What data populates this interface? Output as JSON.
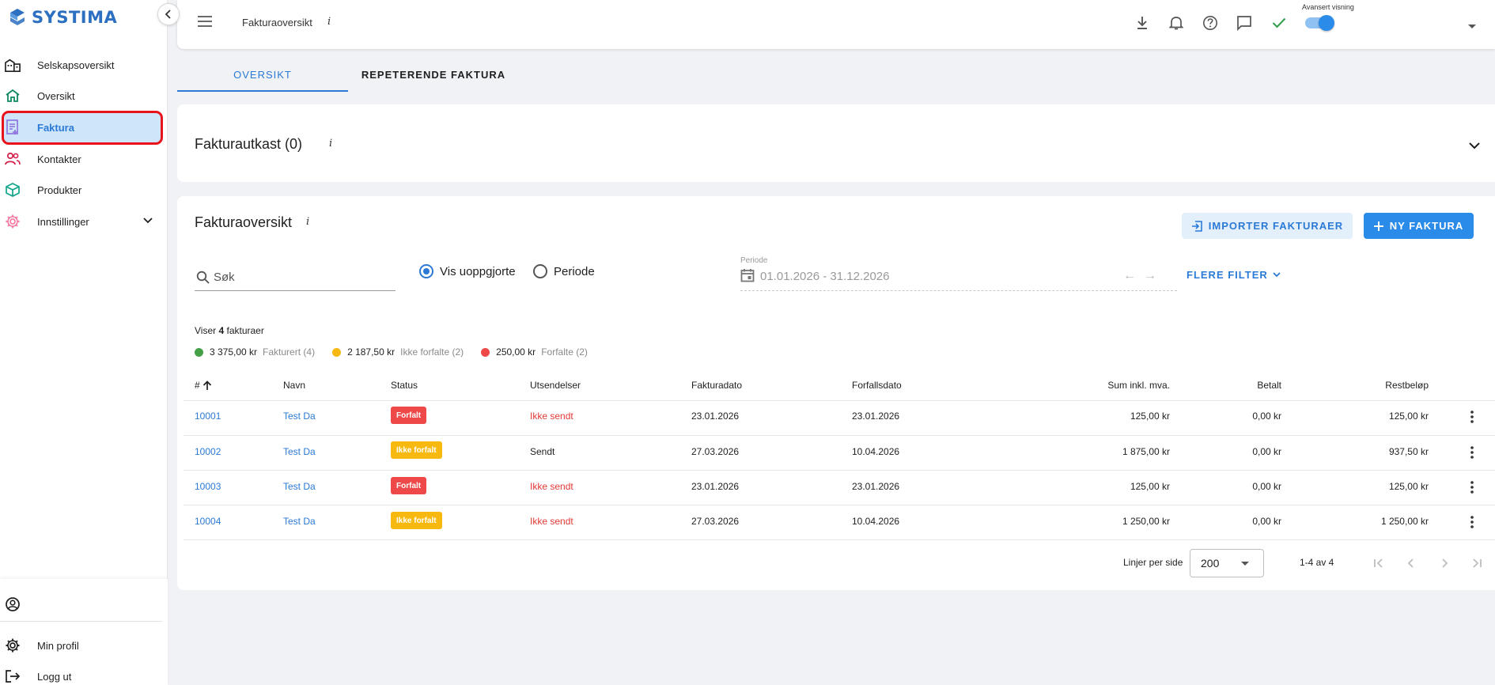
{
  "sidebar": {
    "logo_text": "SYSTIMA",
    "items": [
      {
        "label": "Selskapsoversikt"
      },
      {
        "label": "Oversikt"
      },
      {
        "label": "Faktura"
      },
      {
        "label": "Kontakter"
      },
      {
        "label": "Produkter"
      },
      {
        "label": "Innstillinger"
      }
    ],
    "bottom": {
      "profile_label": "Min profil",
      "logout_label": "Logg ut"
    }
  },
  "header": {
    "title": "Fakturaoversikt",
    "info": "i",
    "advanced_label": "Avansert visning",
    "advanced_on": true
  },
  "tabs": [
    {
      "label": "OVERSIKT",
      "active": true
    },
    {
      "label": "REPETERENDE FAKTURA",
      "active": false
    }
  ],
  "draft": {
    "title": "Fakturautkast (0)",
    "info": "i"
  },
  "overview": {
    "title": "Fakturaoversikt",
    "info": "i",
    "import_label": "IMPORTER FAKTURAER",
    "new_label": "NY FAKTURA",
    "search_placeholder": "Søk",
    "radio_unsettled": "Vis uoppgjorte",
    "radio_period": "Periode",
    "period_label": "Periode",
    "period_value": "01.01.2026 - 31.12.2026",
    "period_arrows": "←→",
    "more_filter": "FLERE FILTER",
    "count_prefix": "Viser ",
    "count_number": "4",
    "count_suffix": " fakturaer",
    "summary": [
      {
        "amount": "3 375,00 kr",
        "label": "Fakturert (4)",
        "color": "#43a047"
      },
      {
        "amount": "2 187,50 kr",
        "label": "Ikke forfalte (2)",
        "color": "#f7b90f"
      },
      {
        "amount": "250,00 kr",
        "label": "Forfalte (2)",
        "color": "#ef4848"
      }
    ]
  },
  "table": {
    "columns": {
      "number": "#",
      "name": "Navn",
      "status": "Status",
      "sent": "Utsendelser",
      "date": "Fakturadato",
      "due": "Forfallsdato",
      "sum": "Sum inkl. mva.",
      "paid": "Betalt",
      "rest": "Restbeløp"
    },
    "rows": [
      {
        "number": "10001",
        "name": "Test Da",
        "status": "Forfalt",
        "status_color": "#ef4848",
        "sent": "Ikke sendt",
        "sent_red": true,
        "date": "23.01.2026",
        "due": "23.01.2026",
        "sum": "125,00 kr",
        "paid": "0,00 kr",
        "rest": "125,00 kr"
      },
      {
        "number": "10002",
        "name": "Test Da",
        "status": "Ikke forfalt",
        "status_color": "#f7b90f",
        "sent": "Sendt",
        "sent_red": false,
        "date": "27.03.2026",
        "due": "10.04.2026",
        "sum": "1 875,00 kr",
        "paid": "0,00 kr",
        "rest": "937,50 kr"
      },
      {
        "number": "10003",
        "name": "Test Da",
        "status": "Forfalt",
        "status_color": "#ef4848",
        "sent": "Ikke sendt",
        "sent_red": true,
        "date": "23.01.2026",
        "due": "23.01.2026",
        "sum": "125,00 kr",
        "paid": "0,00 kr",
        "rest": "125,00 kr"
      },
      {
        "number": "10004",
        "name": "Test Da",
        "status": "Ikke forfalt",
        "status_color": "#f7b90f",
        "sent": "Ikke sendt",
        "sent_red": true,
        "date": "27.03.2026",
        "due": "10.04.2026",
        "sum": "1 250,00 kr",
        "paid": "0,00 kr",
        "rest": "1 250,00 kr"
      }
    ]
  },
  "pagination": {
    "rows_label": "Linjer per side",
    "rows_value": "200",
    "range": "1-4 av 4"
  }
}
